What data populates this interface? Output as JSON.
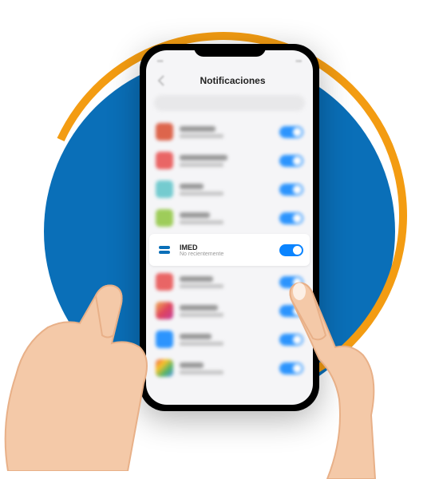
{
  "page_title": "Notificaciones",
  "focused_app": {
    "name": "IMED",
    "subtitle": "No recientemente"
  },
  "app_icons": [
    {
      "color": "#d94c2f"
    },
    {
      "color": "#e84c4c"
    },
    {
      "color": "#5ec4c9"
    },
    {
      "color": "#8fc63f"
    },
    {
      "color_special": "imed"
    },
    {
      "color": "#e84c4c"
    },
    {
      "gradient": "linear-gradient(135deg,#f09433,#e6683c,#dc2743,#cc2366,#bc1888)"
    },
    {
      "color": "#0a84ff"
    },
    {
      "gradient": "linear-gradient(135deg,#ea4335,#fbbc05,#34a853,#4285f4)"
    }
  ],
  "toggle_state": "on",
  "colors": {
    "accent": "#0a84ff",
    "bg_circle": "#0a6fb8",
    "arc": "#f39c12",
    "skin": "#f4c9a8",
    "skin_shadow": "#e8b088"
  }
}
